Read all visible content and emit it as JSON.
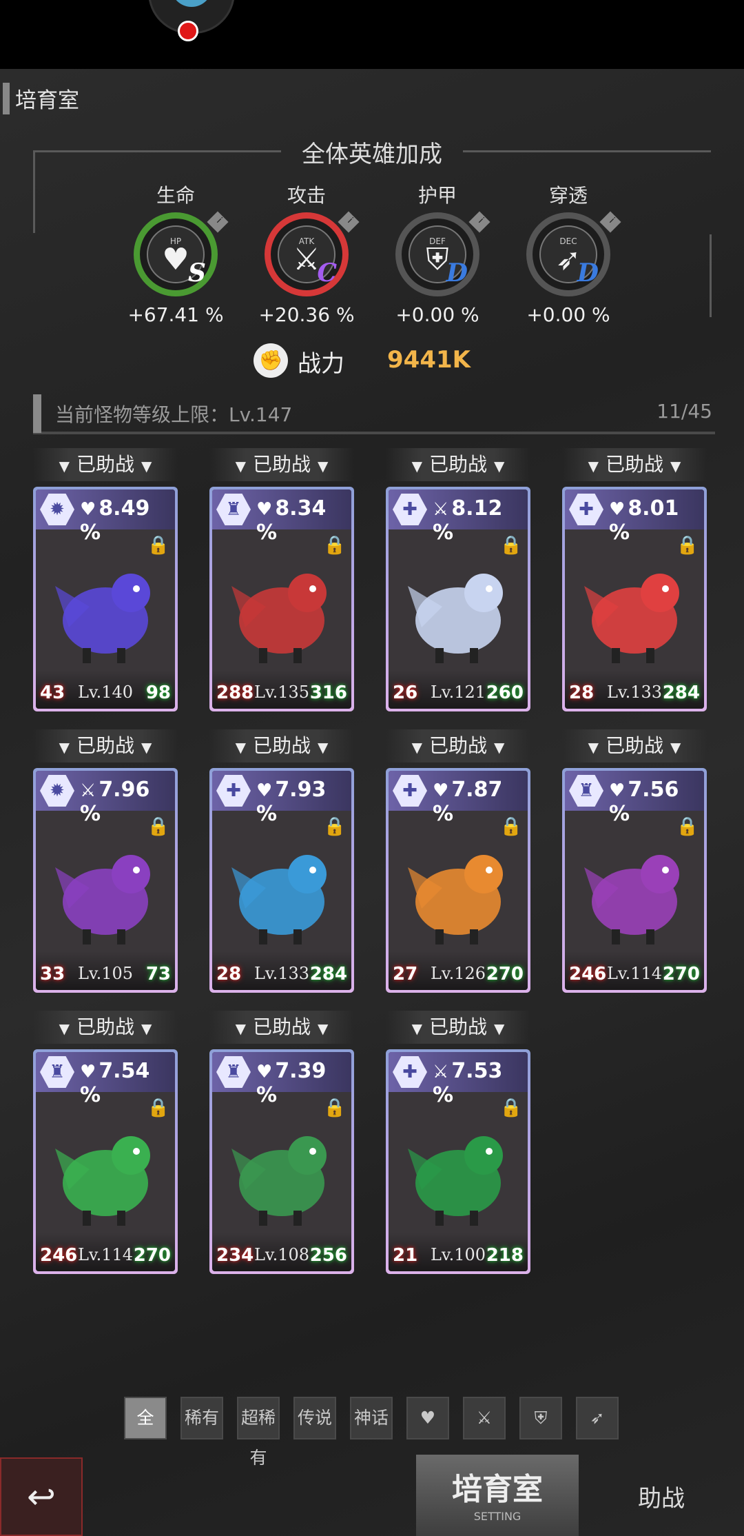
{
  "section_title": "培育室",
  "bonus": {
    "title": "全体英雄加成",
    "stats": [
      {
        "label": "生命",
        "tag": "HP",
        "glyph": "♥",
        "grade": "S",
        "grade_color": "#ffffff",
        "ring_color": "#4a9a32",
        "value": "+67.41 %"
      },
      {
        "label": "攻击",
        "tag": "ATK",
        "glyph": "⚔",
        "grade": "C",
        "grade_color": "#a45cf0",
        "ring_color": "#d63838",
        "value": "+20.36 %"
      },
      {
        "label": "护甲",
        "tag": "DEF",
        "glyph": "⛨",
        "grade": "D",
        "grade_color": "#3a7be0",
        "ring_color": "#555555",
        "value": "+0.00 %"
      },
      {
        "label": "穿透",
        "tag": "DEC",
        "glyph": "➶",
        "grade": "D",
        "grade_color": "#3a7be0",
        "ring_color": "#555555",
        "value": "+0.00 %"
      }
    ]
  },
  "power": {
    "label": "战力",
    "value": "9441K"
  },
  "cap": {
    "text": "当前怪物等级上限：Lv.147",
    "count": "11/45"
  },
  "assist_label": "已助战",
  "cards": [
    {
      "type_icon": "✹",
      "stat_icon": "♥",
      "percent": "8.49 %",
      "hp": "43",
      "level": "Lv.140",
      "def": "98",
      "color": "#5a48d8"
    },
    {
      "type_icon": "♜",
      "stat_icon": "♥",
      "percent": "8.34 %",
      "hp": "288",
      "level": "Lv.135",
      "def": "316",
      "color": "#c83838"
    },
    {
      "type_icon": "✚",
      "stat_icon": "⚔",
      "percent": "8.12 %",
      "hp": "26",
      "level": "Lv.121",
      "def": "260",
      "color": "#c8d4f0"
    },
    {
      "type_icon": "✚",
      "stat_icon": "♥",
      "percent": "8.01 %",
      "hp": "28",
      "level": "Lv.133",
      "def": "284",
      "color": "#e04040"
    },
    {
      "type_icon": "✹",
      "stat_icon": "⚔",
      "percent": "7.96 %",
      "hp": "33",
      "level": "Lv.105",
      "def": "73",
      "color": "#8a40c0"
    },
    {
      "type_icon": "✚",
      "stat_icon": "♥",
      "percent": "7.93 %",
      "hp": "28",
      "level": "Lv.133",
      "def": "284",
      "color": "#3a9ad8"
    },
    {
      "type_icon": "✚",
      "stat_icon": "♥",
      "percent": "7.87 %",
      "hp": "27",
      "level": "Lv.126",
      "def": "270",
      "color": "#e88a30"
    },
    {
      "type_icon": "♜",
      "stat_icon": "♥",
      "percent": "7.56 %",
      "hp": "246",
      "level": "Lv.114",
      "def": "270",
      "color": "#9a40b8"
    },
    {
      "type_icon": "♜",
      "stat_icon": "♥",
      "percent": "7.54 %",
      "hp": "246",
      "level": "Lv.114",
      "def": "270",
      "color": "#3ab050"
    },
    {
      "type_icon": "♜",
      "stat_icon": "♥",
      "percent": "7.39 %",
      "hp": "234",
      "level": "Lv.108",
      "def": "256",
      "color": "#3a9850"
    },
    {
      "type_icon": "✚",
      "stat_icon": "⚔",
      "percent": "7.53 %",
      "hp": "21",
      "level": "Lv.100",
      "def": "218",
      "color": "#2a9a48"
    }
  ],
  "filters": [
    "全",
    "稀有",
    "超稀有",
    "传说",
    "神话",
    "♥",
    "⚔",
    "⛨",
    "➶"
  ],
  "bottom": {
    "back_icon": "↩",
    "main_tab": "培育室",
    "main_tab_sub": "SETTING",
    "assist_tab": "助战"
  }
}
